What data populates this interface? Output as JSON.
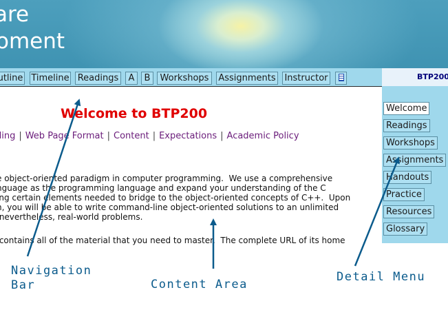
{
  "banner": {
    "line1": "are",
    "line2": "oment"
  },
  "navbar": {
    "items": [
      "utline",
      "Timeline",
      "Readings",
      "A",
      "B",
      "Workshops",
      "Assignments",
      "Instructor"
    ],
    "icon": "document-icon"
  },
  "course_tab": "BTP200",
  "content": {
    "welcome": "Welcome to BTP200",
    "links": [
      "ading",
      "Web Page Format",
      "Content",
      "Expectations",
      "Academic Policy"
    ],
    "paragraph1": "e object-oriented paradigm in computer programming.  We use a comprehensive\nnguage as the programming language and expand your understanding of the C\ning certain elements needed to bridge to the object-oriented concepts of C++.  Upon\nn, you will be able to write command-line object-oriented solutions to an unlimited\n nevertheless, real-world problems.",
    "paragraph2": " contains all of the material that you need to master.  The complete URL of its home"
  },
  "detail_menu": {
    "items": [
      "Welcome",
      "Readings",
      "Workshops",
      "Assignments",
      "Handouts",
      "Practice",
      "Resources",
      "Glossary"
    ],
    "active": "Welcome"
  },
  "annotations": {
    "nav_bar_line1": "Navigation",
    "nav_bar_line2": "Bar",
    "content_area": "Content Area",
    "detail_menu": "Detail Menu"
  },
  "colors": {
    "banner": "#4d9fbd",
    "nav_bg": "#9fd8ec",
    "welcome_red": "#e00000",
    "link_purple": "#6a1c7a",
    "annotation_blue": "#0b5b8c"
  }
}
